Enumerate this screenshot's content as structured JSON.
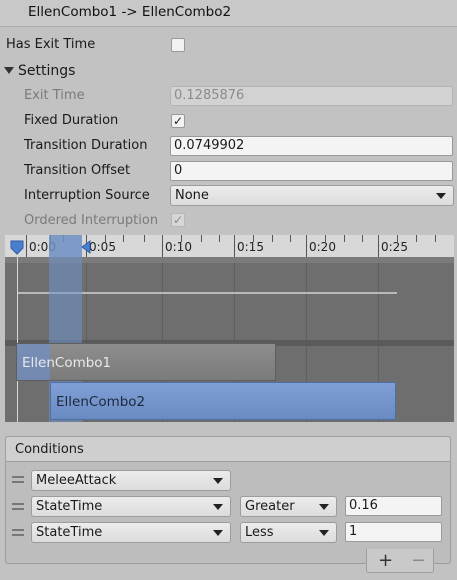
{
  "window": {
    "title": "EllenCombo1 -> EllenCombo2"
  },
  "has_exit_time": {
    "label": "Has Exit Time",
    "checked": false
  },
  "settings": {
    "label": "Settings",
    "exit_time": {
      "label": "Exit Time",
      "value": "0.1285876"
    },
    "fixed_duration": {
      "label": "Fixed Duration",
      "mark": "✓"
    },
    "transition_duration": {
      "label": "Transition Duration",
      "value": "0.0749902"
    },
    "transition_offset": {
      "label": "Transition Offset",
      "value": "0"
    },
    "interruption_source": {
      "label": "Interruption Source",
      "value": "None"
    },
    "ordered_interruption": {
      "label": "Ordered Interruption",
      "mark": "✓"
    }
  },
  "timeline": {
    "ticks": [
      "0:00",
      "0:05",
      "0:10",
      "0:15",
      "0:20",
      "0:25"
    ],
    "clips": [
      "EllenCombo1",
      "EllenCombo2"
    ]
  },
  "conditions": {
    "header": "Conditions",
    "rows": [
      {
        "parameter": "MeleeAttack",
        "mode": "",
        "value": ""
      },
      {
        "parameter": "StateTime",
        "mode": "Greater",
        "value": "0.16"
      },
      {
        "parameter": "StateTime",
        "mode": "Less",
        "value": "1"
      }
    ],
    "add": "+",
    "remove": "−"
  },
  "colors": {
    "accent_blue": "#7092c8",
    "timeline_bg": "#6e6e6e",
    "panel_bg": "#c2c2c2"
  }
}
